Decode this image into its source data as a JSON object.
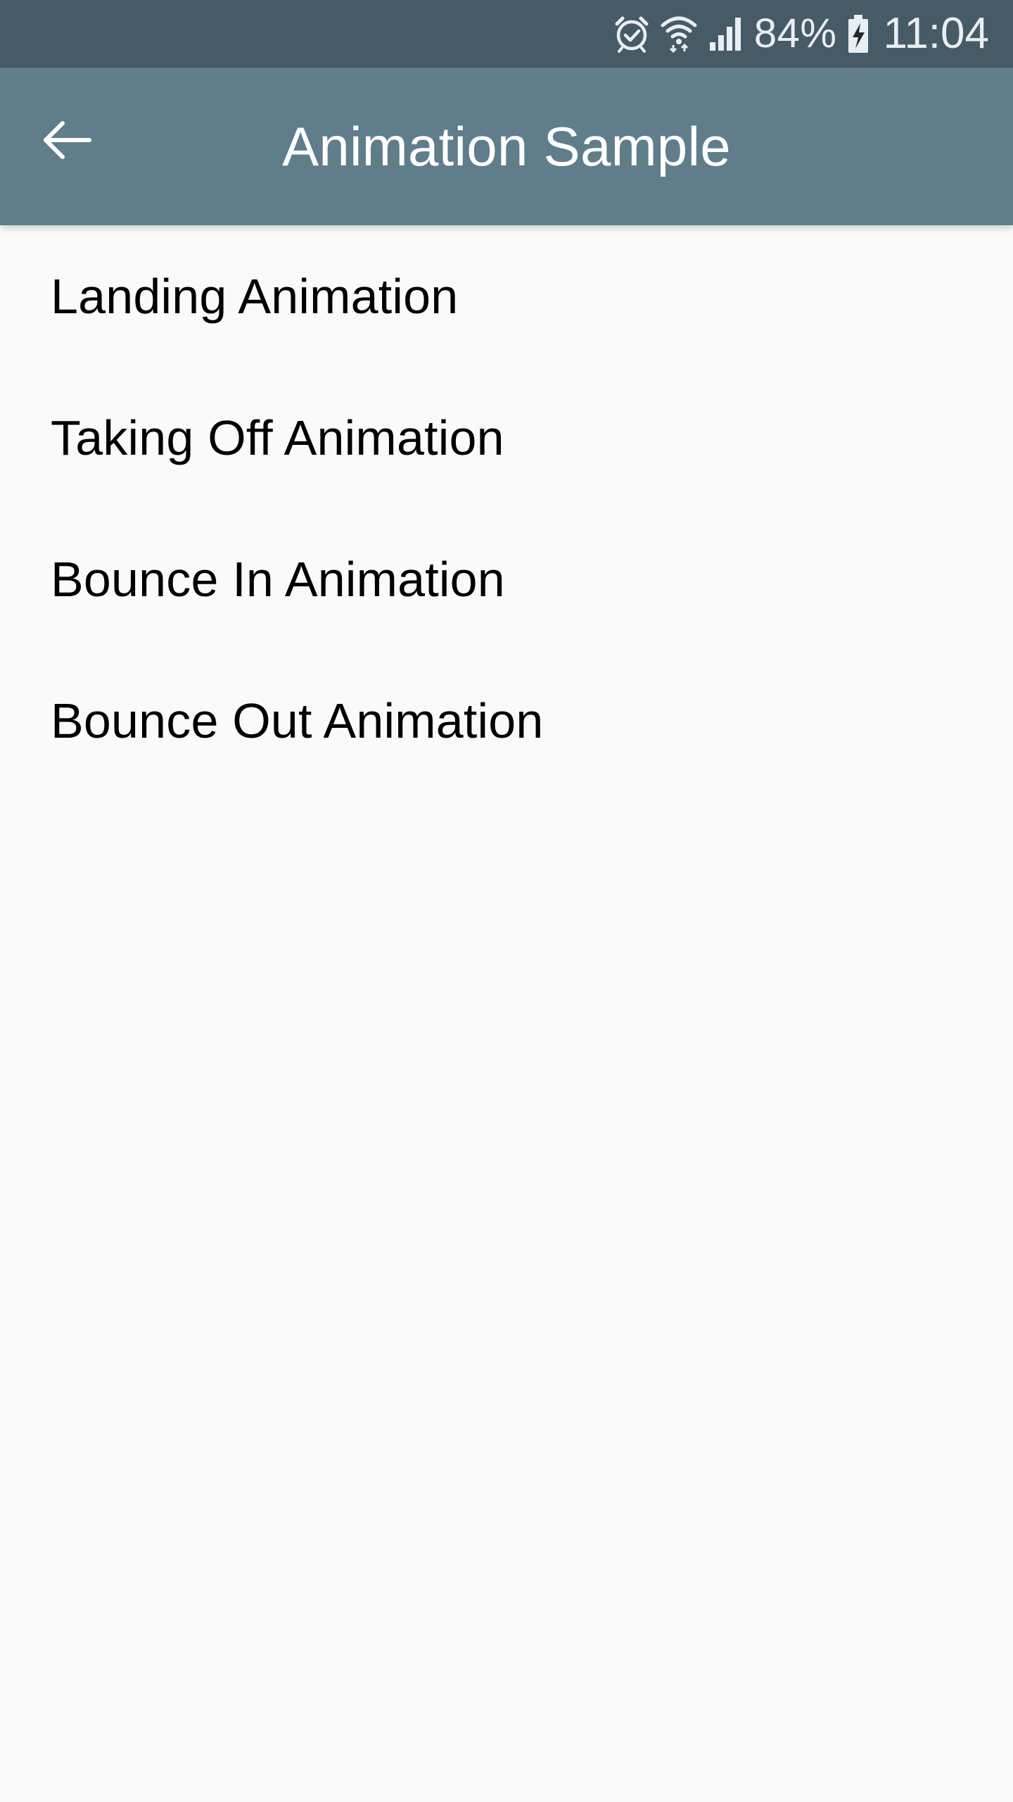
{
  "status_bar": {
    "battery_percent": "84%",
    "time": "11:04",
    "icons": [
      "alarm-icon",
      "wifi-icon",
      "cellular-signal-icon",
      "battery-charging-icon"
    ],
    "background": "#475B67"
  },
  "app_bar": {
    "title": "Animation Sample",
    "back_icon": "arrow-back-icon",
    "background": "#607D8B"
  },
  "list": {
    "items": [
      {
        "label": "Landing Animation"
      },
      {
        "label": "Taking Off Animation"
      },
      {
        "label": "Bounce In Animation"
      },
      {
        "label": "Bounce Out Animation"
      }
    ]
  },
  "page": {
    "background": "#FAFAFA"
  }
}
